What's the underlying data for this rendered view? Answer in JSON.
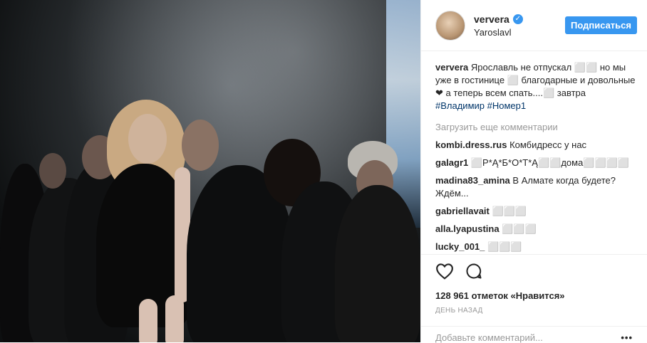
{
  "post": {
    "username": "ververa",
    "verified_badge": "✓",
    "location": "Yaroslavl",
    "follow_label": "Подписаться",
    "caption": {
      "user": "ververa",
      "text": "Ярославль не отпускал ⬜⬜ но мы уже в гостинице ⬜ благодарные и довольные❤ а теперь всем спать....⬜ завтра ",
      "tags": [
        "#Владимир",
        "#Номер1"
      ]
    },
    "load_more": "Загрузить еще комментарии",
    "comments": [
      {
        "user": "kombi.dress.rus",
        "text": "Комбидресс у нас"
      },
      {
        "user": "galagr1",
        "text": "⬜Р*Ą*Б*О*Т*Ą⬜⬜дома⬜⬜⬜⬜"
      },
      {
        "user": "madina83_amina",
        "text": "В Алмате когда будете? Ждём..."
      },
      {
        "user": "gabriellavait",
        "text": "⬜⬜⬜"
      },
      {
        "user": "alla.lyapustina",
        "text": "⬜⬜⬜"
      },
      {
        "user": "lucky_001_",
        "text": "⬜⬜⬜"
      }
    ],
    "icons": {
      "like": "heart-icon",
      "comment": "comment-icon",
      "options": "more-options-icon"
    },
    "likes": "128 961 отметок «Нравится»",
    "date": "ДЕНЬ НАЗАД",
    "add_comment_placeholder": "Добавьте комментарий...",
    "options_label": "•••"
  }
}
